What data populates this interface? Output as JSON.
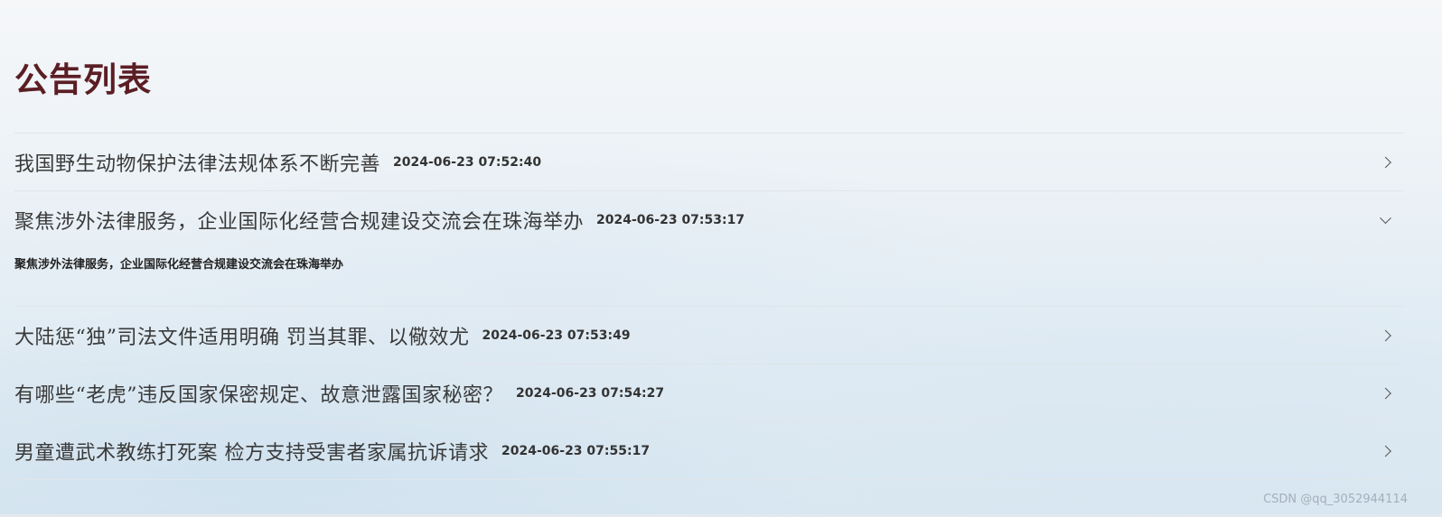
{
  "header": {
    "title": "公告列表"
  },
  "announcements": [
    {
      "title": "我国野生动物保护法律法规体系不断完善",
      "time": "2024-06-23 07:52:40",
      "expanded": false,
      "chevron_icon": "chevron-right-icon"
    },
    {
      "title": "聚焦涉外法律服务，企业国际化经营合规建设交流会在珠海举办",
      "time": "2024-06-23 07:53:17",
      "expanded": true,
      "chevron_icon": "chevron-down-icon",
      "content": "聚焦涉外法律服务，企业国际化经营合规建设交流会在珠海举办"
    },
    {
      "title": "大陆惩“独”司法文件适用明确 罚当其罪、以儆效尤",
      "time": "2024-06-23 07:53:49",
      "expanded": false,
      "chevron_icon": "chevron-right-icon"
    },
    {
      "title": "有哪些“老虎”违反国家保密规定、故意泄露国家秘密？",
      "time": "2024-06-23 07:54:27",
      "expanded": false,
      "chevron_icon": "chevron-right-icon"
    },
    {
      "title": "男童遭武术教练打死案 检方支持受害者家属抗诉请求",
      "time": "2024-06-23 07:55:17",
      "expanded": false,
      "chevron_icon": "chevron-right-icon"
    }
  ],
  "watermark": "CSDN @qq_3052944114",
  "colors": {
    "title": "#5b1e24",
    "text": "#3a3a3a",
    "divider": "#dfe5ea"
  }
}
